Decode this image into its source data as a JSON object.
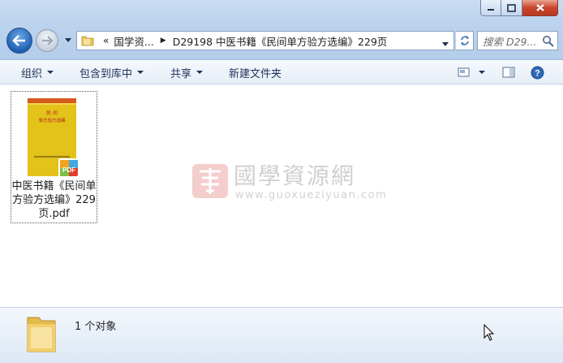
{
  "window": {
    "controls": {
      "minimize": "minimize",
      "maximize": "maximize",
      "close": "close"
    }
  },
  "navigation": {
    "back_icon": "back-arrow-icon",
    "forward_icon": "forward-arrow-icon",
    "address": {
      "overflow": "«",
      "crumbs": [
        "国学资...",
        "D29198 中医书籍《民间单方验方选编》229页"
      ]
    },
    "search": {
      "placeholder": "搜索 D29..."
    }
  },
  "toolbar": {
    "organize": "组织",
    "include_in_library": "包含到库中",
    "share": "共享",
    "new_folder": "新建文件夹"
  },
  "files": [
    {
      "name": "中医书籍《民间单方验方选编》229页.pdf",
      "name_lines": [
        "中医书籍《民间单",
        "方验方选编》229",
        "页.pdf"
      ],
      "thumbnail": {
        "top_text": "民 间",
        "title_text": "单方验方选编",
        "badge": "PDF"
      }
    }
  ],
  "watermark": {
    "title": "國學資源網",
    "url": "www.guoxueziyuan.com"
  },
  "status": {
    "object_count": "1 个对象"
  },
  "colors": {
    "accent": "#1f5fb0",
    "toolbar_text": "#1e3257",
    "book_cover": "#e3c21a",
    "pdf_badge": "#e23d2c"
  }
}
